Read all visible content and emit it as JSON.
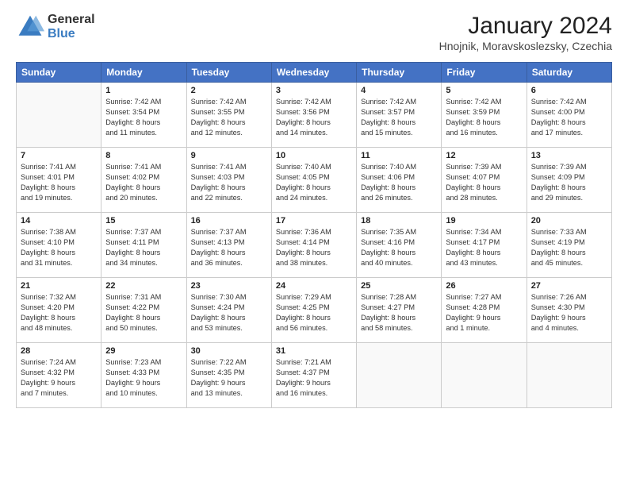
{
  "header": {
    "logo_general": "General",
    "logo_blue": "Blue",
    "month_title": "January 2024",
    "location": "Hnojnik, Moravskoslezsky, Czechia"
  },
  "weekdays": [
    "Sunday",
    "Monday",
    "Tuesday",
    "Wednesday",
    "Thursday",
    "Friday",
    "Saturday"
  ],
  "weeks": [
    [
      {
        "day": "",
        "info": ""
      },
      {
        "day": "1",
        "info": "Sunrise: 7:42 AM\nSunset: 3:54 PM\nDaylight: 8 hours\nand 11 minutes."
      },
      {
        "day": "2",
        "info": "Sunrise: 7:42 AM\nSunset: 3:55 PM\nDaylight: 8 hours\nand 12 minutes."
      },
      {
        "day": "3",
        "info": "Sunrise: 7:42 AM\nSunset: 3:56 PM\nDaylight: 8 hours\nand 14 minutes."
      },
      {
        "day": "4",
        "info": "Sunrise: 7:42 AM\nSunset: 3:57 PM\nDaylight: 8 hours\nand 15 minutes."
      },
      {
        "day": "5",
        "info": "Sunrise: 7:42 AM\nSunset: 3:59 PM\nDaylight: 8 hours\nand 16 minutes."
      },
      {
        "day": "6",
        "info": "Sunrise: 7:42 AM\nSunset: 4:00 PM\nDaylight: 8 hours\nand 17 minutes."
      }
    ],
    [
      {
        "day": "7",
        "info": "Sunrise: 7:41 AM\nSunset: 4:01 PM\nDaylight: 8 hours\nand 19 minutes."
      },
      {
        "day": "8",
        "info": "Sunrise: 7:41 AM\nSunset: 4:02 PM\nDaylight: 8 hours\nand 20 minutes."
      },
      {
        "day": "9",
        "info": "Sunrise: 7:41 AM\nSunset: 4:03 PM\nDaylight: 8 hours\nand 22 minutes."
      },
      {
        "day": "10",
        "info": "Sunrise: 7:40 AM\nSunset: 4:05 PM\nDaylight: 8 hours\nand 24 minutes."
      },
      {
        "day": "11",
        "info": "Sunrise: 7:40 AM\nSunset: 4:06 PM\nDaylight: 8 hours\nand 26 minutes."
      },
      {
        "day": "12",
        "info": "Sunrise: 7:39 AM\nSunset: 4:07 PM\nDaylight: 8 hours\nand 28 minutes."
      },
      {
        "day": "13",
        "info": "Sunrise: 7:39 AM\nSunset: 4:09 PM\nDaylight: 8 hours\nand 29 minutes."
      }
    ],
    [
      {
        "day": "14",
        "info": "Sunrise: 7:38 AM\nSunset: 4:10 PM\nDaylight: 8 hours\nand 31 minutes."
      },
      {
        "day": "15",
        "info": "Sunrise: 7:37 AM\nSunset: 4:11 PM\nDaylight: 8 hours\nand 34 minutes."
      },
      {
        "day": "16",
        "info": "Sunrise: 7:37 AM\nSunset: 4:13 PM\nDaylight: 8 hours\nand 36 minutes."
      },
      {
        "day": "17",
        "info": "Sunrise: 7:36 AM\nSunset: 4:14 PM\nDaylight: 8 hours\nand 38 minutes."
      },
      {
        "day": "18",
        "info": "Sunrise: 7:35 AM\nSunset: 4:16 PM\nDaylight: 8 hours\nand 40 minutes."
      },
      {
        "day": "19",
        "info": "Sunrise: 7:34 AM\nSunset: 4:17 PM\nDaylight: 8 hours\nand 43 minutes."
      },
      {
        "day": "20",
        "info": "Sunrise: 7:33 AM\nSunset: 4:19 PM\nDaylight: 8 hours\nand 45 minutes."
      }
    ],
    [
      {
        "day": "21",
        "info": "Sunrise: 7:32 AM\nSunset: 4:20 PM\nDaylight: 8 hours\nand 48 minutes."
      },
      {
        "day": "22",
        "info": "Sunrise: 7:31 AM\nSunset: 4:22 PM\nDaylight: 8 hours\nand 50 minutes."
      },
      {
        "day": "23",
        "info": "Sunrise: 7:30 AM\nSunset: 4:24 PM\nDaylight: 8 hours\nand 53 minutes."
      },
      {
        "day": "24",
        "info": "Sunrise: 7:29 AM\nSunset: 4:25 PM\nDaylight: 8 hours\nand 56 minutes."
      },
      {
        "day": "25",
        "info": "Sunrise: 7:28 AM\nSunset: 4:27 PM\nDaylight: 8 hours\nand 58 minutes."
      },
      {
        "day": "26",
        "info": "Sunrise: 7:27 AM\nSunset: 4:28 PM\nDaylight: 9 hours\nand 1 minute."
      },
      {
        "day": "27",
        "info": "Sunrise: 7:26 AM\nSunset: 4:30 PM\nDaylight: 9 hours\nand 4 minutes."
      }
    ],
    [
      {
        "day": "28",
        "info": "Sunrise: 7:24 AM\nSunset: 4:32 PM\nDaylight: 9 hours\nand 7 minutes."
      },
      {
        "day": "29",
        "info": "Sunrise: 7:23 AM\nSunset: 4:33 PM\nDaylight: 9 hours\nand 10 minutes."
      },
      {
        "day": "30",
        "info": "Sunrise: 7:22 AM\nSunset: 4:35 PM\nDaylight: 9 hours\nand 13 minutes."
      },
      {
        "day": "31",
        "info": "Sunrise: 7:21 AM\nSunset: 4:37 PM\nDaylight: 9 hours\nand 16 minutes."
      },
      {
        "day": "",
        "info": ""
      },
      {
        "day": "",
        "info": ""
      },
      {
        "day": "",
        "info": ""
      }
    ]
  ]
}
